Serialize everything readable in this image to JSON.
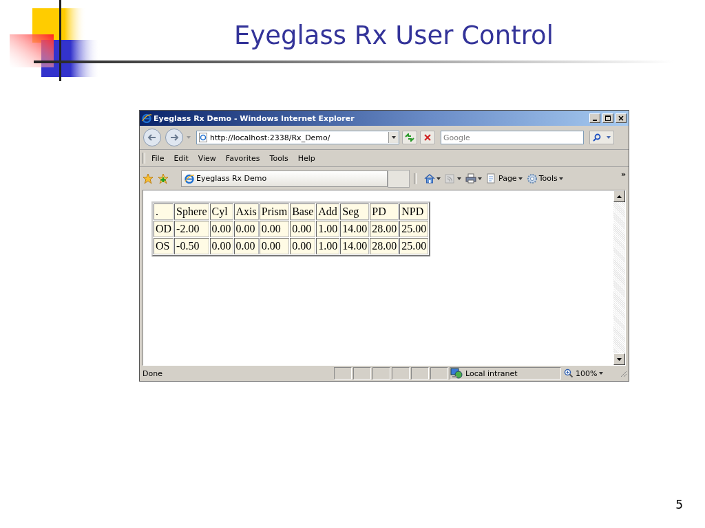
{
  "slide": {
    "title": "Eyeglass Rx User Control",
    "page_number": "5"
  },
  "browser": {
    "window_title": "Eyeglass Rx Demo - Windows Internet Explorer",
    "address": "http://localhost:2338/Rx_Demo/",
    "search": {
      "placeholder": "Google"
    },
    "menu": [
      "File",
      "Edit",
      "View",
      "Favorites",
      "Tools",
      "Help"
    ],
    "tab": {
      "label": "Eyeglass Rx Demo"
    },
    "commands": [
      {
        "kind": "home"
      },
      {
        "kind": "feed"
      },
      {
        "kind": "print"
      },
      {
        "kind": "page",
        "label": "Page"
      },
      {
        "kind": "tools",
        "label": "Tools"
      }
    ],
    "overflow": "»",
    "table": {
      "columns": [
        ".",
        "Sphere",
        "Cyl",
        "Axis",
        "Prism",
        "Base",
        "Add",
        "Seg",
        "PD",
        "NPD"
      ],
      "rows": [
        [
          "OD",
          "-2.00",
          "0.00",
          "0.00",
          "0.00",
          "0.00",
          "1.00",
          "14.00",
          "28.00",
          "25.00"
        ],
        [
          "OS",
          "-0.50",
          "0.00",
          "0.00",
          "0.00",
          "0.00",
          "1.00",
          "14.00",
          "28.00",
          "25.00"
        ]
      ]
    },
    "status_bar": {
      "text": "Done",
      "zone": "Local intranet",
      "zoom": "100%"
    }
  }
}
